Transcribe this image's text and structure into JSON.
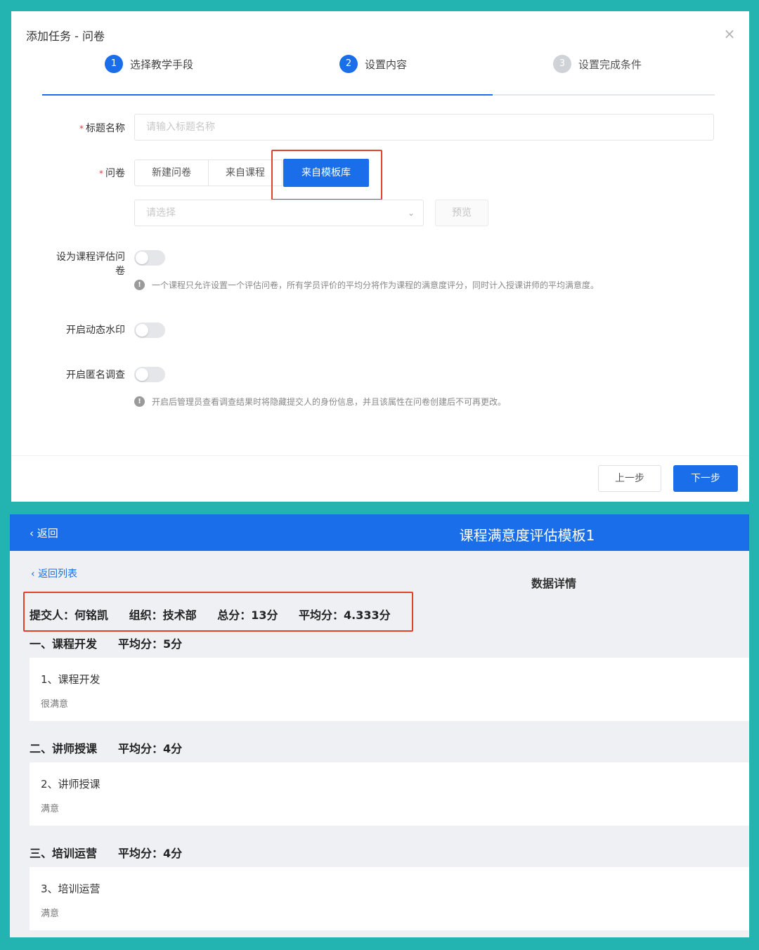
{
  "dialog": {
    "title": "添加任务 - 问卷",
    "close": "×",
    "steps": [
      {
        "num": "1",
        "label": "选择教学手段"
      },
      {
        "num": "2",
        "label": "设置内容"
      },
      {
        "num": "3",
        "label": "设置完成条件"
      }
    ],
    "progress_fraction": 0.67,
    "title_field": {
      "label": "标题名称",
      "placeholder": "请输入标题名称"
    },
    "questionnaire": {
      "label": "问卷",
      "options": [
        "新建问卷",
        "来自课程",
        "来自模板库"
      ],
      "select_placeholder": "请选择",
      "preview_label": "预览"
    },
    "course_eval": {
      "label_line1": "设为课程评估问",
      "label_line2": "卷",
      "tip": "一个课程只允许设置一个评估问卷，所有学员评价的平均分将作为课程的满意度评分，同时计入授课讲师的平均满意度。"
    },
    "watermark": {
      "label": "开启动态水印"
    },
    "anonymous": {
      "label": "开启匿名调查",
      "tip": "开启后管理员查看调查结果时将隐藏提交人的身份信息，并且该属性在问卷创建后不可再更改。"
    },
    "prev_label": "上一步",
    "next_label": "下一步"
  },
  "detail": {
    "back": "返回",
    "title": "课程满意度评估模板1",
    "back_list": "返回列表",
    "section_title": "数据详情",
    "summary": {
      "submitter": "提交人：何铭凯",
      "org": "组织：技术部",
      "total": "总分：13分",
      "avg": "平均分：4.333分"
    },
    "sections": [
      {
        "head": "一、课程开发",
        "avg": "平均分：5分",
        "question": "1、课程开发",
        "answer": "很满意"
      },
      {
        "head": "二、讲师授课",
        "avg": "平均分：4分",
        "question": "2、讲师授课",
        "answer": "满意"
      },
      {
        "head": "三、培训运营",
        "avg": "平均分：4分",
        "question": "3、培训运营",
        "answer": "满意"
      }
    ]
  },
  "colors": {
    "accent": "#1a6ee9",
    "highlight": "#e0402c",
    "frame": "#23b3b0"
  }
}
